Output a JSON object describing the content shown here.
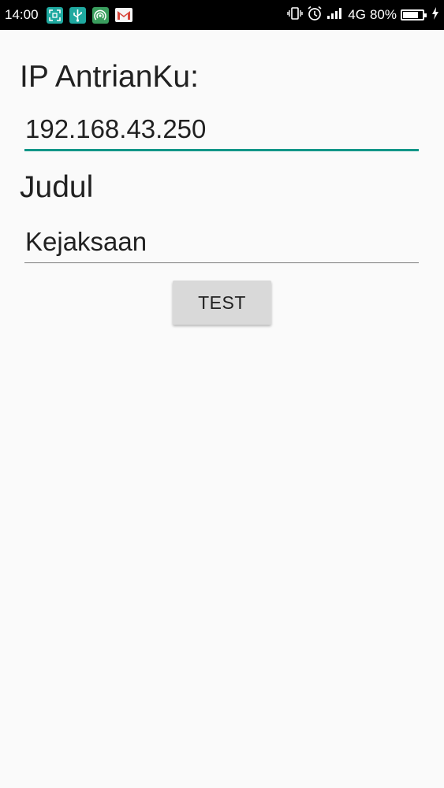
{
  "status_bar": {
    "time": "14:00",
    "network": "4G",
    "battery": "80%",
    "battery_level": 0.8,
    "icons": [
      "screenshot-icon",
      "usb-icon",
      "hotspot-icon",
      "gmail-icon",
      "vibrate-icon",
      "alarm-icon",
      "signal-icon",
      "battery-icon",
      "charging-icon"
    ]
  },
  "form": {
    "ip_label": "IP AntrianKu:",
    "ip_value": "192.168.43.250",
    "judul_label": "Judul",
    "judul_value": "Kejaksaan",
    "test_button": "TEST"
  },
  "colors": {
    "accent": "#129688",
    "status_bar": "#000000",
    "background": "#fafafa",
    "button": "#d9d9d9"
  }
}
